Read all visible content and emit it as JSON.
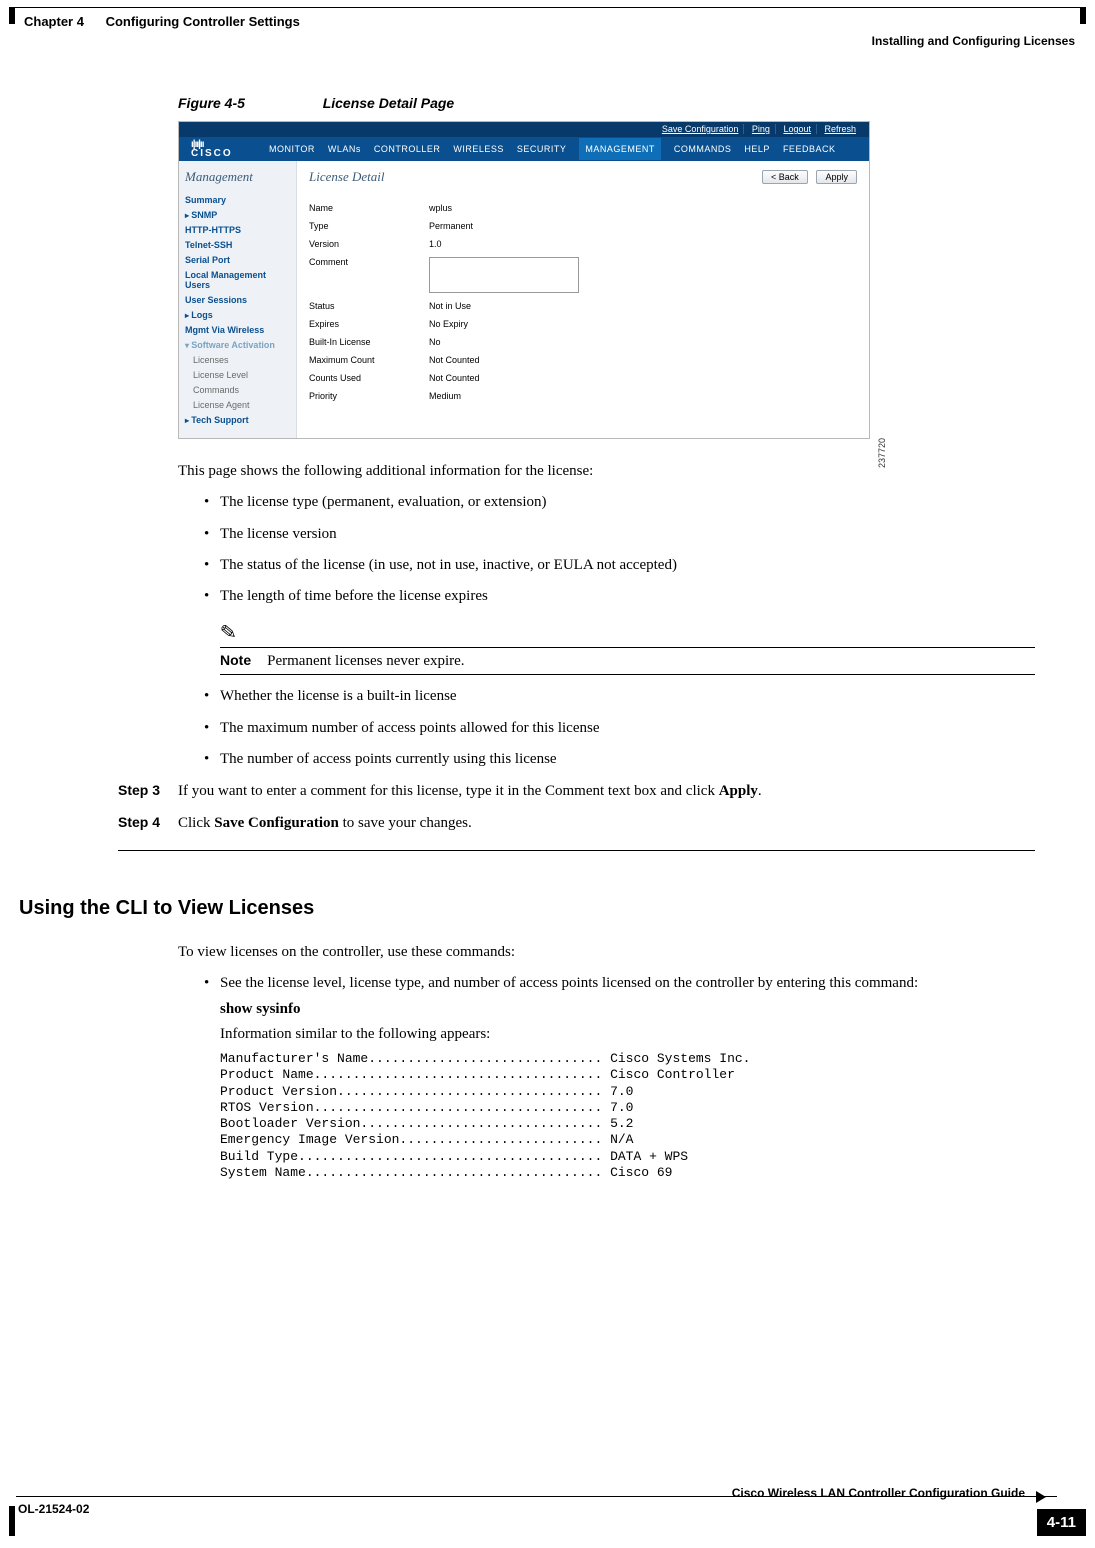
{
  "header": {
    "chapter_label": "Chapter 4",
    "chapter_title": "Configuring Controller Settings",
    "section_title": "Installing and Configuring Licenses"
  },
  "figure": {
    "label": "Figure 4-5",
    "title": "License Detail Page",
    "image_ref": "237720"
  },
  "shot": {
    "toplinks": {
      "save": "Save Configuration",
      "ping": "Ping",
      "logout": "Logout",
      "refresh": "Refresh"
    },
    "logo": {
      "bars": "ı|ıı|ıı",
      "text": "CISCO"
    },
    "tabs": {
      "monitor": "MONITOR",
      "wlans": "WLANs",
      "controller": "CONTROLLER",
      "wireless": "WIRELESS",
      "security": "SECURITY",
      "management": "MANAGEMENT",
      "commands": "COMMANDS",
      "help": "HELP",
      "feedback": "FEEDBACK"
    },
    "sidebar": {
      "title": "Management",
      "items": {
        "summary": "Summary",
        "snmp": "SNMP",
        "http": "HTTP-HTTPS",
        "telnet": "Telnet-SSH",
        "serial": "Serial Port",
        "local": "Local Management Users",
        "sessions": "User Sessions",
        "logs": "Logs",
        "mgmt": "Mgmt Via Wireless",
        "swact": "Software Activation",
        "licenses": "Licenses",
        "level": "License Level",
        "commands": "Commands",
        "agent": "License Agent",
        "tech": "Tech Support"
      }
    },
    "main": {
      "title": "License Detail",
      "buttons": {
        "back": "< Back",
        "apply": "Apply"
      },
      "rows": {
        "name_k": "Name",
        "name_v": "wplus",
        "type_k": "Type",
        "type_v": "Permanent",
        "version_k": "Version",
        "version_v": "1.0",
        "comment_k": "Comment",
        "status_k": "Status",
        "status_v": "Not in Use",
        "expires_k": "Expires",
        "expires_v": "No Expiry",
        "builtin_k": "Built-In License",
        "builtin_v": "No",
        "maxcount_k": "Maximum Count",
        "maxcount_v": "Not Counted",
        "used_k": "Counts Used",
        "used_v": "Not Counted",
        "priority_k": "Priority",
        "priority_v": "Medium"
      }
    }
  },
  "body": {
    "intro": "This page shows the following additional information for the license:",
    "bul1": {
      "a": "The license type (permanent, evaluation, or extension)",
      "b": "The license version",
      "c": "The status of the license (in use, not in use, inactive, or EULA not accepted)",
      "d": "The length of time before the license expires"
    },
    "note_label": "Note",
    "note_text": "Permanent licenses never expire.",
    "bul2": {
      "a": "Whether the license is a built-in license",
      "b": "The maximum number of access points allowed for this license",
      "c": "The number of access points currently using this license"
    },
    "step3": {
      "label": "Step 3",
      "pre": "If you want to enter a comment for this license, type it in the Comment text box and click ",
      "bold": "Apply",
      "post": "."
    },
    "step4": {
      "label": "Step 4",
      "pre": "Click ",
      "bold": "Save Configuration",
      "post": " to save your changes."
    }
  },
  "cli": {
    "heading": "Using the CLI to View Licenses",
    "intro": "To view licenses on the controller, use these commands:",
    "bullet": "See the license level, license type, and number of access points licensed on the controller by entering this command:",
    "cmd": "show sysinfo",
    "lead": "Information similar to the following appears:",
    "output": "Manufacturer's Name.............................. Cisco Systems Inc.\nProduct Name..................................... Cisco Controller\nProduct Version.................................. 7.0\nRTOS Version..................................... 7.0\nBootloader Version............................... 5.2\nEmergency Image Version.......................... N/A\nBuild Type....................................... DATA + WPS\nSystem Name...................................... Cisco 69"
  },
  "footer": {
    "guide": "Cisco Wireless LAN Controller Configuration Guide",
    "ol": "OL-21524-02",
    "page": "4-11"
  }
}
